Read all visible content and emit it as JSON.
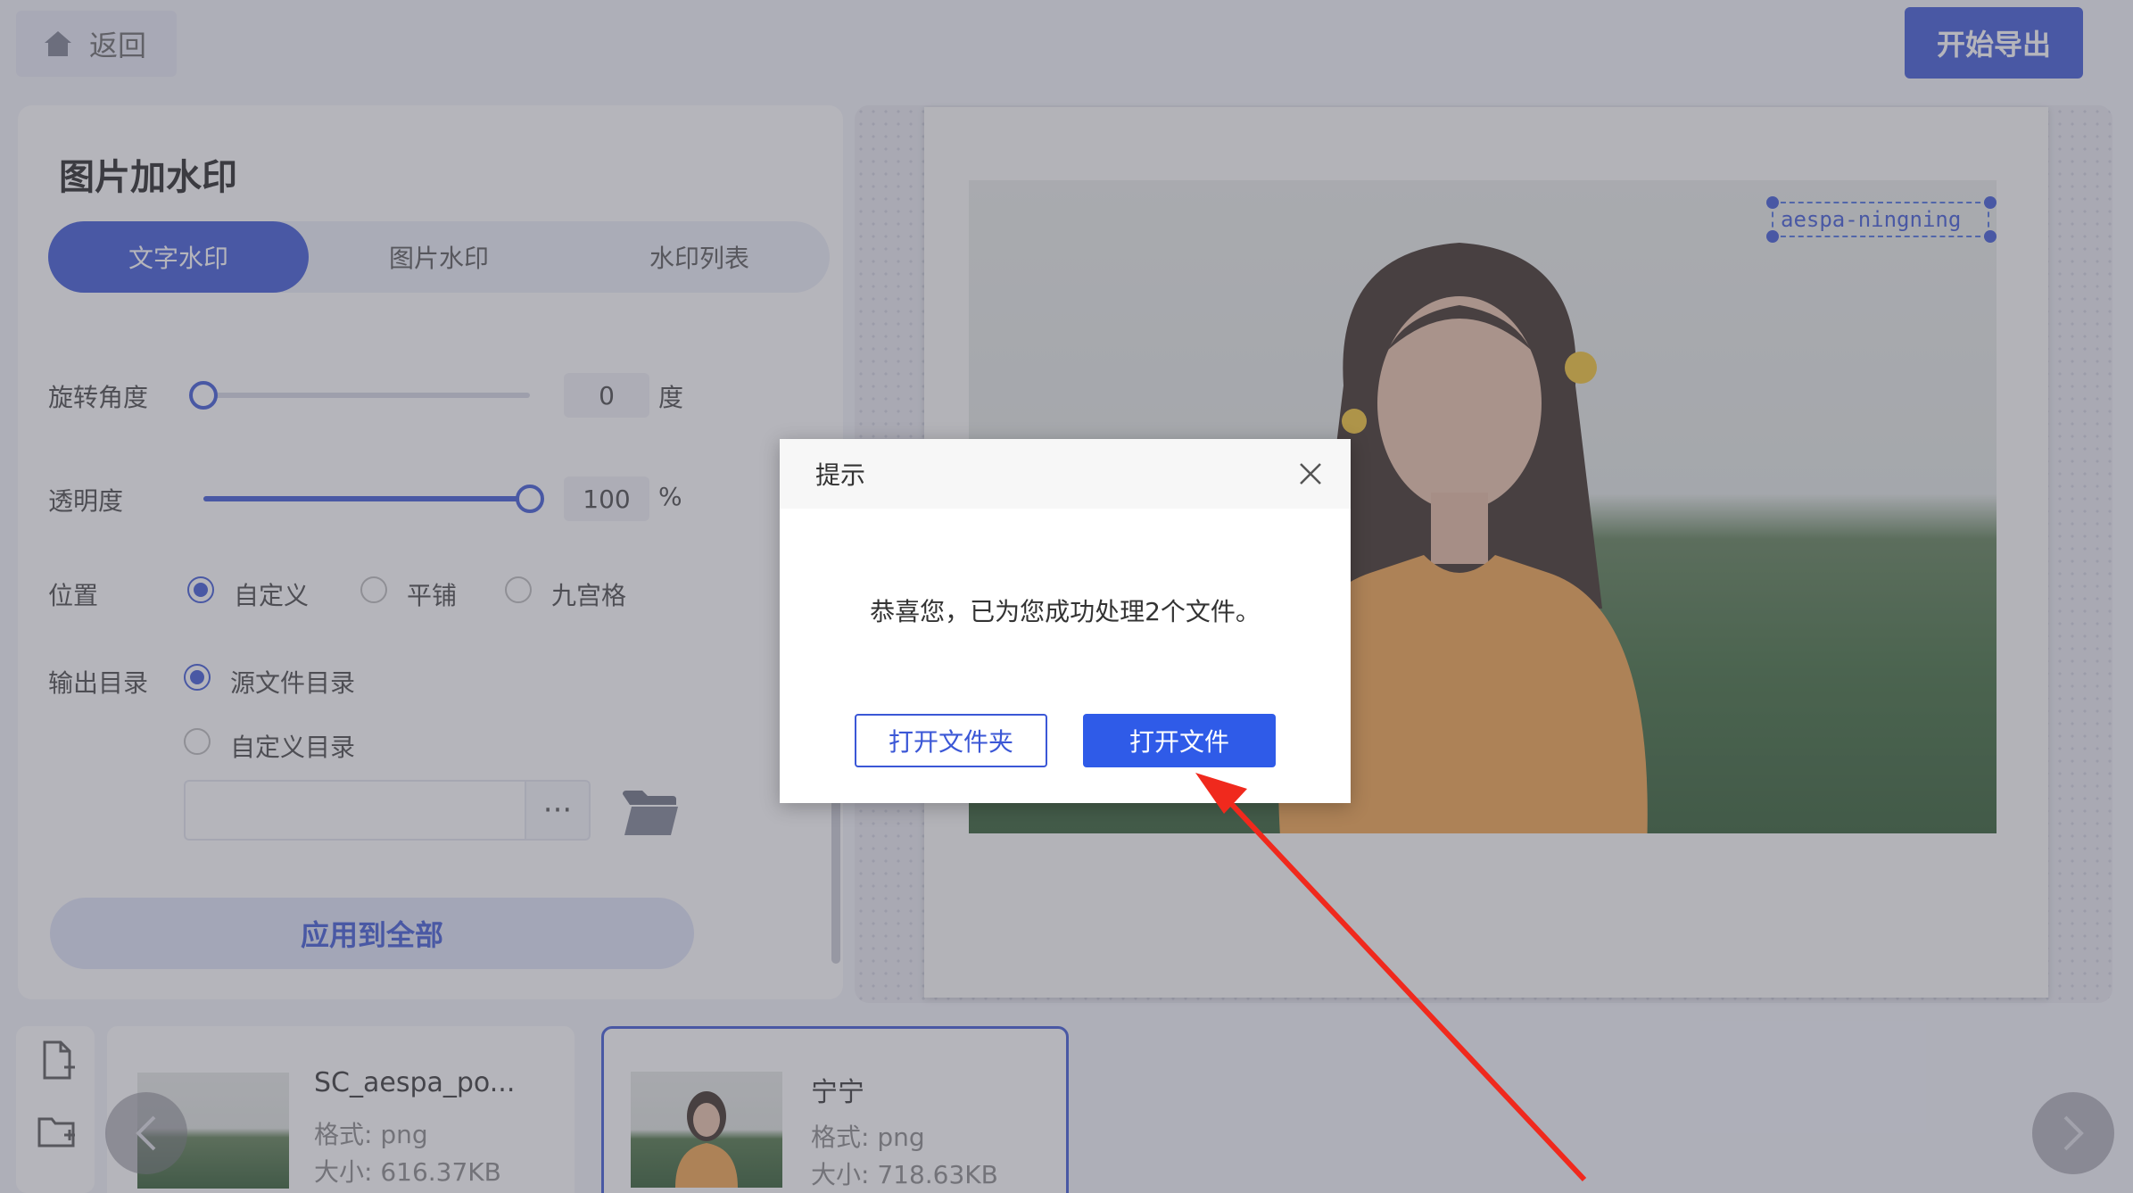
{
  "header": {
    "back_label": "返回",
    "export_label": "开始导出"
  },
  "panel": {
    "title": "图片加水印",
    "tabs": [
      {
        "label": "文字水印",
        "active": true
      },
      {
        "label": "图片水印",
        "active": false
      },
      {
        "label": "水印列表",
        "active": false
      }
    ],
    "rotation": {
      "label": "旋转角度",
      "value": "0",
      "unit": "度",
      "fraction": 0.0
    },
    "opacity": {
      "label": "透明度",
      "value": "100",
      "unit": "%",
      "fraction": 1.0
    },
    "position": {
      "label": "位置",
      "options": [
        {
          "label": "自定义",
          "checked": true
        },
        {
          "label": "平铺",
          "checked": false
        },
        {
          "label": "九宫格",
          "checked": false
        }
      ]
    },
    "output": {
      "label": "输出目录",
      "options": [
        {
          "label": "源文件目录",
          "checked": true
        },
        {
          "label": "自定义目录",
          "checked": false
        }
      ],
      "browse_label": "···"
    },
    "apply_label": "应用到全部"
  },
  "preview": {
    "watermark_text": "aespa-ningning"
  },
  "files": [
    {
      "name": "SC_aespa_po...",
      "format": "格式: png",
      "size": "大小: 616.37KB",
      "selected": false
    },
    {
      "name": "宁宁",
      "format": "格式: png",
      "size": "大小: 718.63KB",
      "selected": true
    }
  ],
  "dialog": {
    "title": "提示",
    "message": "恭喜您，已为您成功处理2个文件。",
    "open_folder_label": "打开文件夹",
    "open_file_label": "打开文件"
  },
  "colors": {
    "accent": "#3b57d6",
    "annotation_arrow": "#f0291d"
  }
}
